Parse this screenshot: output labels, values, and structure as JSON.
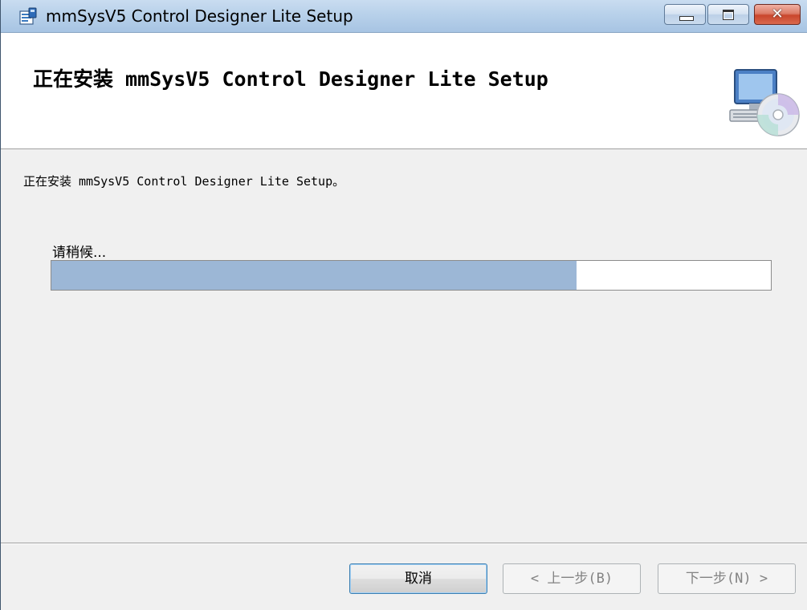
{
  "window": {
    "title": "mmSysV5 Control Designer Lite Setup",
    "app_icon": "installer-icon",
    "controls": {
      "minimize_icon": "minimize-icon",
      "maximize_icon": "maximize-icon",
      "close_icon": "close-icon",
      "close_glyph": "✕"
    }
  },
  "header": {
    "title": "正在安装 mmSysV5 Control Designer Lite Setup",
    "graphic_icon": "computer-cd-icon"
  },
  "body": {
    "message": "正在安装 mmSysV5 Control Designer Lite Setup。",
    "wait_label": "请稍候...",
    "progress_fraction": 0.73
  },
  "footer": {
    "cancel_label": "取消",
    "back_label": "< 上一步(B)",
    "next_label": "下一步(N) >"
  },
  "colors": {
    "progress_fill": "#9cb7d6",
    "titlebar": "#b8d1ea",
    "close_button": "#c9462c"
  }
}
